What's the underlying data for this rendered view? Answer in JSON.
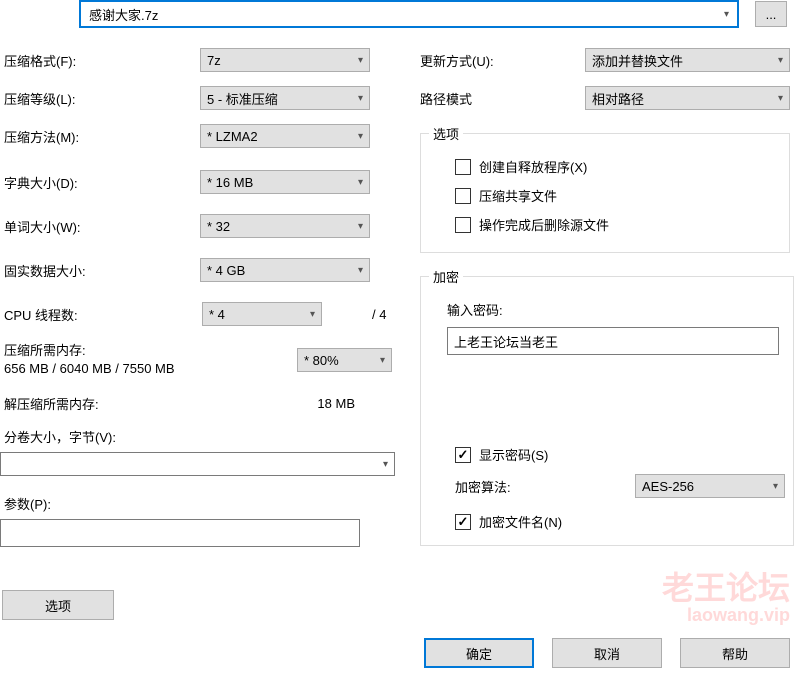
{
  "archive": {
    "filename": "感谢大家.7z",
    "browse": "..."
  },
  "left": {
    "format_label": "压缩格式(F):",
    "format_value": "7z",
    "level_label": "压缩等级(L):",
    "level_value": "5 - 标准压缩",
    "method_label": "压缩方法(M):",
    "method_value": "* LZMA2",
    "dict_label": "字典大小(D):",
    "dict_value": "* 16 MB",
    "word_label": "单词大小(W):",
    "word_value": "* 32",
    "solid_label": "固实数据大小:",
    "solid_value": "* 4 GB",
    "threads_label": "CPU 线程数:",
    "threads_value": "* 4",
    "threads_max": "/ 4",
    "compress_mem_label": "压缩所需内存:",
    "compress_mem_combo": "* 80%",
    "compress_mem_detail": "656 MB / 6040 MB / 7550 MB",
    "decompress_mem_label": "解压缩所需内存:",
    "decompress_mem_value": "18 MB",
    "split_label": "分卷大小，字节(V):",
    "params_label": "参数(P):",
    "options_btn": "选项"
  },
  "right": {
    "update_label": "更新方式(U):",
    "update_value": "添加并替换文件",
    "path_label": "路径模式",
    "path_value": "相对路径",
    "options_legend": "选项",
    "sfx": "创建自释放程序(X)",
    "shared": "压缩共享文件",
    "delete_after": "操作完成后删除源文件",
    "encrypt_legend": "加密",
    "enter_pwd": "输入密码:",
    "pwd_value": "上老王论坛当老王",
    "show_pwd": "显示密码(S)",
    "enc_method_label": "加密算法:",
    "enc_method_value": "AES-256",
    "enc_names": "加密文件名(N)"
  },
  "buttons": {
    "ok": "确定",
    "cancel": "取消",
    "help": "帮助"
  },
  "watermark": {
    "main": "老王论坛",
    "sub": "laowang.vip"
  }
}
